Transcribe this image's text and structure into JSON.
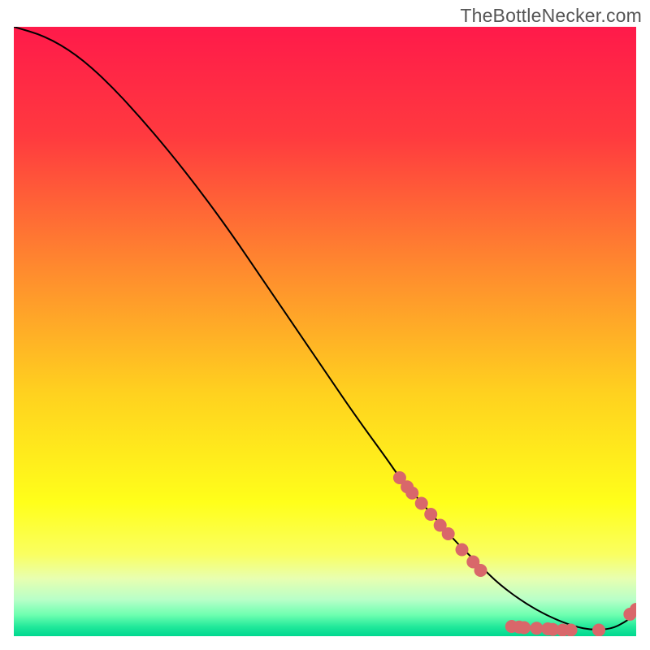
{
  "watermark": "TheBottleNecker.com",
  "chart_data": {
    "type": "line",
    "title": "",
    "xlabel": "",
    "ylabel": "",
    "xlim": [
      0,
      100
    ],
    "ylim": [
      0,
      100
    ],
    "grid": false,
    "background": {
      "type": "vertical-gradient",
      "stops": [
        {
          "pos": 0.0,
          "color": "#ff1a4a"
        },
        {
          "pos": 0.18,
          "color": "#ff3a3f"
        },
        {
          "pos": 0.4,
          "color": "#ff8b2e"
        },
        {
          "pos": 0.6,
          "color": "#ffd11f"
        },
        {
          "pos": 0.78,
          "color": "#ffff1a"
        },
        {
          "pos": 0.865,
          "color": "#faff60"
        },
        {
          "pos": 0.905,
          "color": "#e8ffb0"
        },
        {
          "pos": 0.94,
          "color": "#b8ffc8"
        },
        {
          "pos": 0.965,
          "color": "#6effb0"
        },
        {
          "pos": 0.985,
          "color": "#20e89a"
        },
        {
          "pos": 1.0,
          "color": "#00d890"
        }
      ]
    },
    "series": [
      {
        "name": "bottleneck-curve",
        "type": "line",
        "color": "#000000",
        "x": [
          0,
          5,
          10,
          15,
          20,
          25,
          30,
          35,
          40,
          45,
          50,
          55,
          60,
          62,
          65,
          68,
          71,
          75,
          78,
          82,
          86,
          90,
          93,
          96,
          98,
          99.5,
          100
        ],
        "y": [
          100,
          98.5,
          95.5,
          91,
          85.5,
          79.5,
          73,
          66,
          58.5,
          51,
          43.5,
          36,
          29,
          26,
          22.5,
          19,
          15.5,
          11.5,
          8.5,
          5.5,
          3.2,
          1.6,
          1.0,
          1.2,
          2.2,
          3.3,
          4.2
        ]
      },
      {
        "name": "data-points",
        "type": "scatter",
        "color": "#d9676a",
        "radius": 8,
        "points": [
          {
            "x": 62.0,
            "y": 26.0
          },
          {
            "x": 63.2,
            "y": 24.5
          },
          {
            "x": 64.0,
            "y": 23.5
          },
          {
            "x": 65.5,
            "y": 21.8
          },
          {
            "x": 67.0,
            "y": 20.0
          },
          {
            "x": 68.5,
            "y": 18.2
          },
          {
            "x": 69.8,
            "y": 16.8
          },
          {
            "x": 72.0,
            "y": 14.2
          },
          {
            "x": 73.8,
            "y": 12.2
          },
          {
            "x": 75.0,
            "y": 10.8
          },
          {
            "x": 80.0,
            "y": 1.6
          },
          {
            "x": 81.2,
            "y": 1.5
          },
          {
            "x": 82.0,
            "y": 1.4
          },
          {
            "x": 84.0,
            "y": 1.3
          },
          {
            "x": 85.8,
            "y": 1.2
          },
          {
            "x": 86.6,
            "y": 1.1
          },
          {
            "x": 88.2,
            "y": 1.0
          },
          {
            "x": 89.5,
            "y": 1.0
          },
          {
            "x": 94.0,
            "y": 1.0
          },
          {
            "x": 99.0,
            "y": 3.6
          },
          {
            "x": 100.0,
            "y": 4.4
          }
        ]
      }
    ]
  }
}
